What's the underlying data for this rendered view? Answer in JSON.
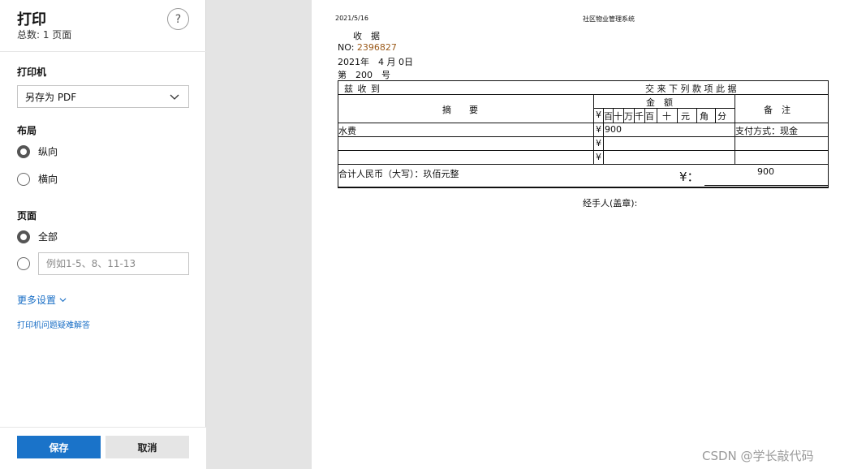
{
  "panel": {
    "title": "打印",
    "subtitle": "总数: 1 页面",
    "help_icon": "?",
    "printer_label": "打印机",
    "printer_value": "另存为 PDF",
    "layout_label": "布局",
    "layout_portrait": "纵向",
    "layout_landscape": "横向",
    "pages_label": "页面",
    "pages_all": "全部",
    "pages_range_placeholder": "例如1-5、8、11-13",
    "more_settings": "更多设置",
    "troubleshoot": "打印机问题疑难解答",
    "save": "保存",
    "cancel": "取消"
  },
  "sheet": {
    "date": "2021/5/16",
    "system_name": "社区物业管理系统",
    "receipt_title": "收　据",
    "no_label": "NO:",
    "no_value": "2396827",
    "issue_date": "2021年　4 月 0日",
    "number_line": "第　200　号",
    "received_from": "兹 收 到",
    "items_header": "交 来 下 列 款 项 此 据",
    "summary_header": "摘　　要",
    "amount_header": "金　额",
    "remark_header": "备　注",
    "digits": [
      "¥",
      "百",
      "十",
      "万",
      "千",
      "百",
      "十",
      "元",
      "角",
      "分"
    ],
    "currency_mark": "¥",
    "row1_item": "水费",
    "row1_amount": "900",
    "row1_remark": "支付方式：现金",
    "total_label": "合计人民币（大写）：玖佰元整",
    "total_mark": "¥：",
    "total_value": "900",
    "handler": "经手人(盖章):"
  },
  "watermark": "CSDN @学长敲代码",
  "colors": {
    "accent": "#1a73c9",
    "no_value": "#9b5a1a",
    "link": "#1a6fc6"
  }
}
